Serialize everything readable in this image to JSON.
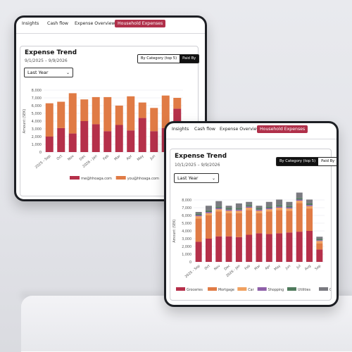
{
  "back": {
    "tabs": [
      "Insights",
      "Cash flow",
      "Expense Overview",
      "Household Expenses"
    ],
    "active_tab": 3,
    "title": "Expense Trend",
    "date_range": "9/1/2025 – 9/9/2026",
    "segment": {
      "options": [
        "By Category (top 5)",
        "Paid By"
      ],
      "active": 1
    },
    "period_select": "Last Year"
  },
  "front": {
    "tabs": [
      "Insights",
      "Cash flow",
      "Expense Overview",
      "Household Expenses"
    ],
    "active_tab": 3,
    "title": "Expense Trend",
    "date_range": "10/1/2025 – 9/9/2026",
    "segment": {
      "options": [
        "By Category (top 5)",
        "Paid By"
      ],
      "active": 0
    },
    "period_select": "Last Year"
  },
  "icons": {
    "select_chevron": "chevron-down-icon"
  },
  "chart_data": [
    {
      "type": "bar",
      "stacked": true,
      "categories": [
        "2025 - Sep",
        "Oct",
        "Nov",
        "Dec",
        "2026 - Jan",
        "Feb",
        "Mar",
        "Apr",
        "May",
        "Jun",
        "Jul",
        "Aug"
      ],
      "tick_labels": [
        "2025 - Sep",
        "Oct",
        "Nov",
        "Dec",
        "2026 - Jan",
        "Feb",
        "Mar",
        "Apr",
        "May",
        "Jun"
      ],
      "ylabel": "Amount (SEK)",
      "ylim": [
        0,
        8000
      ],
      "yticks": [
        "0",
        "1,000",
        "2,000",
        "3,000",
        "4,000",
        "5,000",
        "6,000",
        "7,000",
        "8,000"
      ],
      "series": [
        {
          "name": "me@hhoaga.com",
          "color": "#b5304a",
          "values": [
            2000,
            3100,
            2400,
            4000,
            3600,
            2700,
            3500,
            2800,
            4400,
            2700,
            3100,
            5600
          ]
        },
        {
          "name": "you@hhoaga.com",
          "color": "#e07b45",
          "values": [
            4300,
            3400,
            5200,
            2800,
            3500,
            4400,
            2500,
            4400,
            2000,
            3000,
            4200,
            1400
          ]
        }
      ],
      "legend": "bottom"
    },
    {
      "type": "bar",
      "stacked": true,
      "categories": [
        "2025 - Sep",
        "Oct",
        "Nov",
        "Dec",
        "2026 - Jan",
        "Feb",
        "Mar",
        "Apr",
        "May",
        "Jun",
        "Jul",
        "Aug",
        "Sep"
      ],
      "tick_labels": [
        "2025 - Sep",
        "Oct",
        "Nov",
        "Dec",
        "2026 - Jan",
        "Feb",
        "Mar",
        "Apr",
        "May",
        "Jun",
        "Jul",
        "Aug",
        "Sep"
      ],
      "ylabel": "Amount (SEK)",
      "ylim": [
        0,
        8000
      ],
      "yticks": [
        "0",
        "1,000",
        "2,000",
        "3,000",
        "4,000",
        "5,000",
        "6,000",
        "7,000",
        "8,000"
      ],
      "series": [
        {
          "name": "Groceries",
          "color": "#b5304a",
          "values": [
            2600,
            3000,
            3300,
            3300,
            3200,
            3500,
            3700,
            3600,
            3700,
            3800,
            3900,
            4000,
            1600
          ]
        },
        {
          "name": "Mortgage",
          "color": "#e07b45",
          "values": [
            3000,
            3000,
            3200,
            3000,
            3100,
            3200,
            2600,
            2900,
            3000,
            2800,
            3700,
            2900,
            800
          ]
        },
        {
          "name": "Car",
          "color": "#f0a160",
          "values": [
            300,
            300,
            300,
            300,
            300,
            300,
            300,
            300,
            300,
            300,
            300,
            300,
            300
          ]
        },
        {
          "name": "Shopping",
          "color": "#8e5fa8",
          "values": [
            150,
            150,
            150,
            150,
            150,
            150,
            150,
            150,
            150,
            150,
            150,
            150,
            100
          ]
        },
        {
          "name": "Utilities",
          "color": "#4f7a5c",
          "values": [
            200,
            200,
            200,
            200,
            200,
            200,
            200,
            200,
            200,
            200,
            200,
            200,
            150
          ]
        },
        {
          "name": "Others",
          "color": "#7a7a80",
          "values": [
            200,
            600,
            700,
            300,
            600,
            400,
            300,
            600,
            700,
            500,
            700,
            500,
            300
          ]
        }
      ],
      "legend": "bottom"
    }
  ]
}
